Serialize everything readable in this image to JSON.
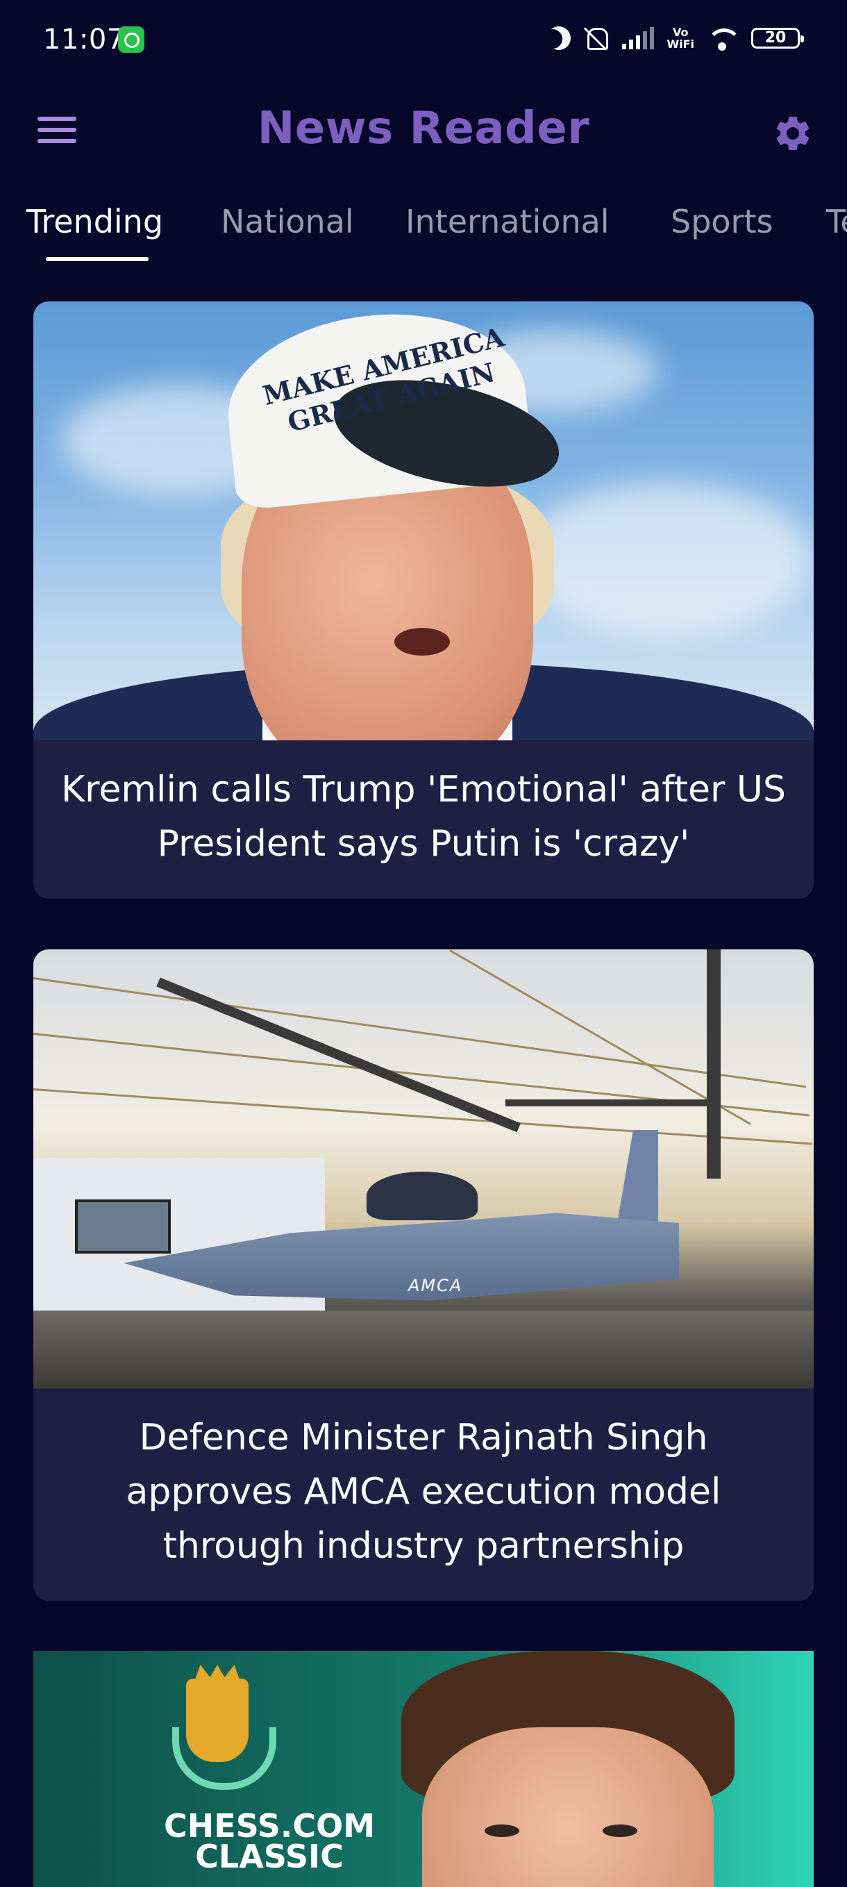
{
  "status_bar": {
    "time": "11:07",
    "vowifi_top": "Vo",
    "vowifi_bottom": "WiFi",
    "battery": "20"
  },
  "app_bar": {
    "title": "News Reader"
  },
  "tabs": [
    {
      "label": "Trending",
      "active": true
    },
    {
      "label": "National",
      "active": false
    },
    {
      "label": "International",
      "active": false
    },
    {
      "label": "Sports",
      "active": false
    },
    {
      "label": "Te",
      "active": false
    }
  ],
  "articles": [
    {
      "title": "Kremlin calls Trump 'Emotional' after US President says Putin is 'crazy'",
      "image_text": "MAKE AMERICA GREAT AGAIN"
    },
    {
      "title": "Defence Minister Rajnath Singh approves AMCA execution model through industry partnership",
      "image_text": "AMCA"
    },
    {
      "title": "",
      "image_text": "CHESS.COM CLASSIC"
    }
  ],
  "colors": {
    "background": "#060729",
    "card": "#1e1f42",
    "accent": "#7d5fc0",
    "tab_inactive": "#9a9aae"
  },
  "icons": {
    "menu": "hamburger-icon",
    "settings": "gear-icon"
  }
}
